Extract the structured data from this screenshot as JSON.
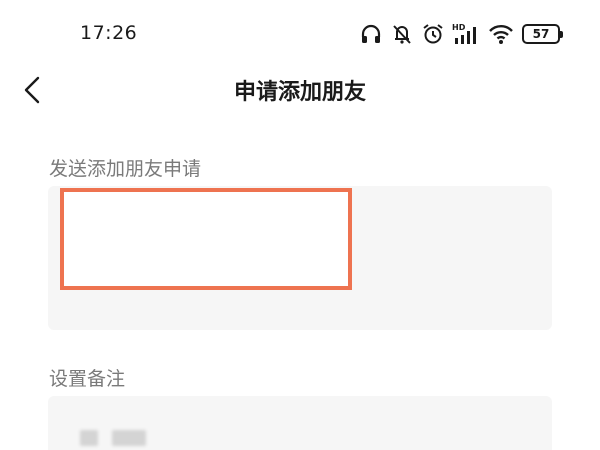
{
  "status_bar": {
    "time": "17:26",
    "battery": "57",
    "icons": [
      "headphones-icon",
      "mute-icon",
      "alarm-icon",
      "hd-signal-icon",
      "wifi-icon",
      "battery-icon"
    ],
    "hd_label": "HD"
  },
  "nav": {
    "back_icon": "chevron-left-icon",
    "title": "申请添加朋友"
  },
  "request_section": {
    "label": "发送添加朋友申请",
    "highlight_color": "#ee7350"
  },
  "remark_section": {
    "label": "设置备注"
  },
  "colors": {
    "input_bg": "#f6f6f6",
    "label_text": "#7a7a7a",
    "title_text": "#1a1a1a"
  }
}
